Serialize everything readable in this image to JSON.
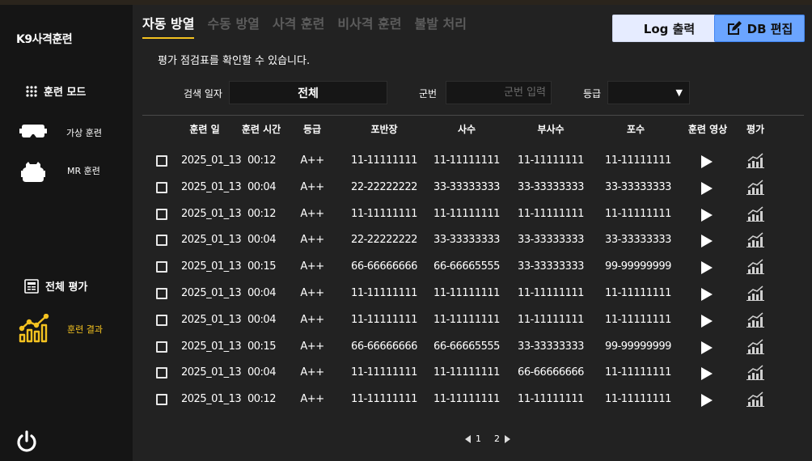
{
  "app": {
    "title": "K9사격훈련"
  },
  "sidebar": {
    "mode_heading": "훈련 모드",
    "items": [
      {
        "label": "가상 훈련",
        "icon": "vr-headset-icon"
      },
      {
        "label": "MR 훈련",
        "icon": "mr-headset-icon"
      }
    ],
    "eval_heading": "전체 평가",
    "result_item": {
      "label": "훈련 결과",
      "icon": "chart-growth-icon",
      "color": "#f4c220"
    },
    "power_icon": "power-icon"
  },
  "tabs": [
    {
      "label": "자동 방열",
      "active": true
    },
    {
      "label": "수동 방열",
      "active": false
    },
    {
      "label": "사격 훈련",
      "active": false
    },
    {
      "label": "비사격 훈련",
      "active": false
    },
    {
      "label": "불발 처리",
      "active": false
    }
  ],
  "subtitle": "평가 점검표를 확인할 수 있습니다.",
  "buttons": {
    "log": "Log 출력",
    "db": "DB 편집"
  },
  "filters": {
    "date_label": "검색 일자",
    "date_value": "전체",
    "unit_label": "군번",
    "unit_placeholder": "군번 입력",
    "grade_label": "등급",
    "grade_value": ""
  },
  "table": {
    "headers": [
      "훈련 일",
      "훈련 시간",
      "등급",
      "포반장",
      "사수",
      "부사수",
      "포수",
      "훈련 영상",
      "평가"
    ],
    "rows": [
      [
        "2025_01_13",
        "00:12",
        "A++",
        "11-11111111",
        "11-11111111",
        "11-11111111",
        "11-11111111"
      ],
      [
        "2025_01_13",
        "00:04",
        "A++",
        "22-22222222",
        "33-33333333",
        "33-33333333",
        "33-33333333"
      ],
      [
        "2025_01_13",
        "00:12",
        "A++",
        "11-11111111",
        "11-11111111",
        "11-11111111",
        "11-11111111"
      ],
      [
        "2025_01_13",
        "00:04",
        "A++",
        "22-22222222",
        "33-33333333",
        "33-33333333",
        "33-33333333"
      ],
      [
        "2025_01_13",
        "00:15",
        "A++",
        "66-66666666",
        "66-66665555",
        "33-33333333",
        "99-99999999"
      ],
      [
        "2025_01_13",
        "00:04",
        "A++",
        "11-11111111",
        "11-11111111",
        "11-11111111",
        "11-11111111"
      ],
      [
        "2025_01_13",
        "00:04",
        "A++",
        "11-11111111",
        "11-11111111",
        "11-11111111",
        "11-11111111"
      ],
      [
        "2025_01_13",
        "00:15",
        "A++",
        "66-66666666",
        "66-66665555",
        "33-33333333",
        "99-99999999"
      ],
      [
        "2025_01_13",
        "00:04",
        "A++",
        "11-11111111",
        "11-11111111",
        "66-66666666",
        "11-11111111"
      ],
      [
        "2025_01_13",
        "00:12",
        "A++",
        "11-11111111",
        "11-11111111",
        "11-11111111",
        "11-11111111"
      ]
    ]
  },
  "pagination": {
    "pages": [
      "1",
      "2"
    ]
  }
}
